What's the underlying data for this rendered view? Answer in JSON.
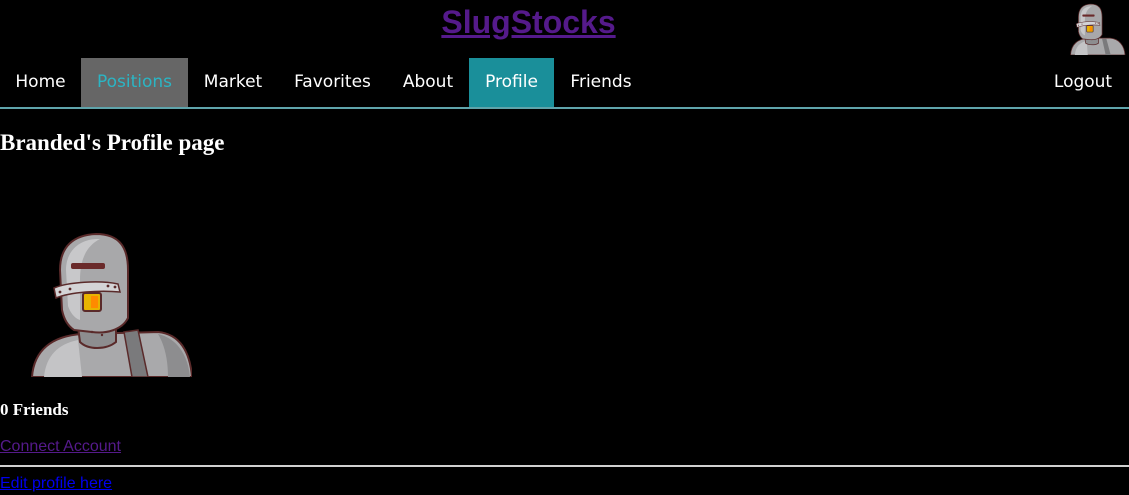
{
  "header": {
    "site_title": "SlugStocks"
  },
  "nav": {
    "home": "Home",
    "positions": "Positions",
    "market": "Market",
    "favorites": "Favorites",
    "about": "About",
    "profile": "Profile",
    "friends": "Friends",
    "logout": "Logout",
    "active_item": "Profile",
    "hovered_item": "Positions"
  },
  "profile": {
    "heading": "Branded's Profile page",
    "avatar_icon": "robot-avatar-icon",
    "friends_count": "0 Friends",
    "connect_link": "Connect Account",
    "edit_link": "Edit profile here"
  },
  "colors": {
    "background": "#000000",
    "active_tab": "#1a8f9a",
    "hover_tab": "#666666",
    "nav_border": "#5fa4ab",
    "visited_link": "#551a8b",
    "link": "#0000ee"
  }
}
